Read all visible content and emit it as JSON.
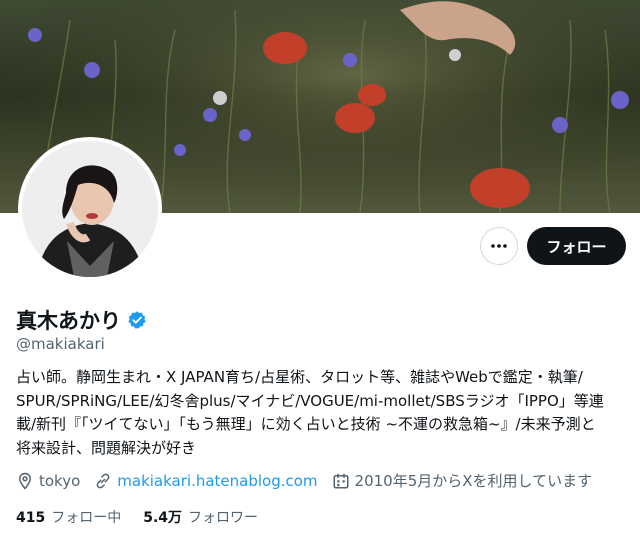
{
  "profile": {
    "name": "真木あかり",
    "handle": "@makiakari",
    "bio": "占い師。静岡生まれ・X JAPAN育ち/占星術、タロット等、雑誌やWebで鑑定・執筆/\nSPUR/SPRiNG/LEE/幻冬舎plus/マイナビ/VOGUE/mi-mollet/SBSラジオ「IPPO」等連\n載/新刊『「ツイてない」「もう無理」に効く占いと技術 ~不運の救急箱~』/未来予測と\n将来設計、問題解決が好き",
    "location": "tokyo",
    "website": "makiakari.hatenablog.com",
    "joined": "2010年5月からXを利用しています",
    "following_count": "415",
    "following_label": "フォロー中",
    "followers_count": "5.4万",
    "followers_label": "フォロワー"
  },
  "actions": {
    "follow_label": "フォロー",
    "more_icon": "more-horizontal-icon"
  },
  "icons": {
    "verified": "verified-badge-icon",
    "location": "location-pin-icon",
    "link": "link-icon",
    "calendar": "calendar-icon"
  },
  "colors": {
    "accent": "#1d9bf0",
    "text_primary": "#0f1419",
    "text_secondary": "#536471",
    "button_dark": "#0f1419"
  }
}
